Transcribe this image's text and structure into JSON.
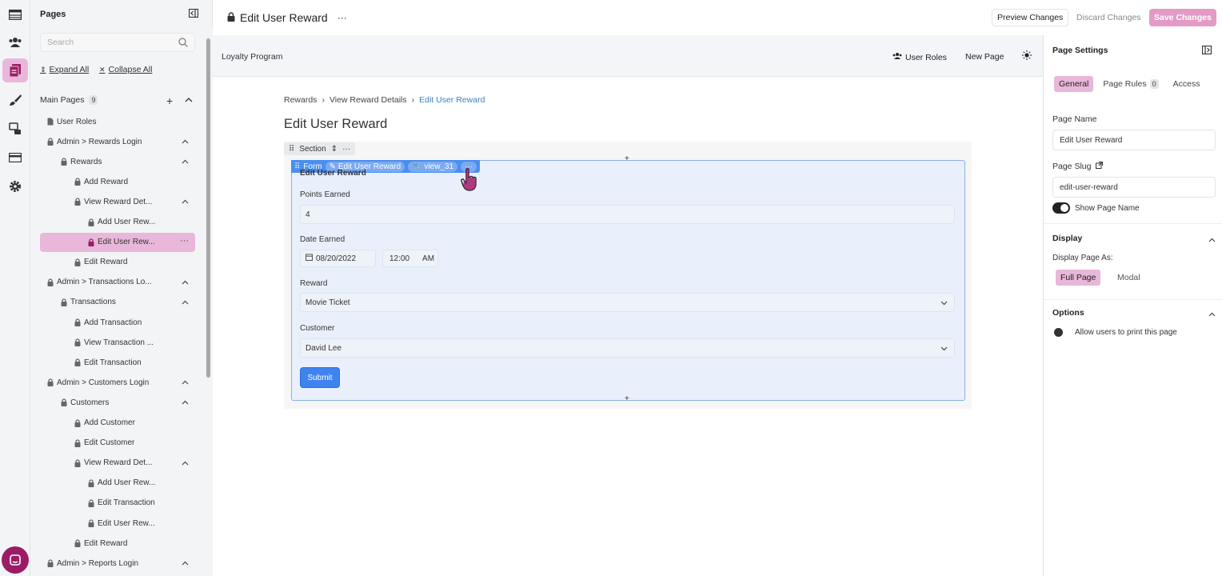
{
  "rail": {
    "icons": [
      "table-icon",
      "users-icon",
      "pages-icon",
      "brush-icon",
      "flows-icon",
      "card-icon",
      "settings-icon"
    ]
  },
  "pages_panel": {
    "title": "Pages",
    "search_placeholder": "Search",
    "expand_all": "Expand All",
    "collapse_all": "Collapse All",
    "main_pages_label": "Main Pages",
    "main_pages_count": "9",
    "tree": [
      {
        "label": "User Roles",
        "indent": 0,
        "icon": "page",
        "caret": false
      },
      {
        "label": "Admin > Rewards Login",
        "indent": 0,
        "icon": "lock",
        "caret": true
      },
      {
        "label": "Rewards",
        "indent": 1,
        "icon": "lock",
        "caret": true
      },
      {
        "label": "Add Reward",
        "indent": 2,
        "icon": "lock",
        "caret": false
      },
      {
        "label": "View Reward Det...",
        "indent": 2,
        "icon": "lock",
        "caret": true
      },
      {
        "label": "Add User Rew...",
        "indent": 3,
        "icon": "lock",
        "caret": false
      },
      {
        "label": "Edit User Rew...",
        "indent": 3,
        "icon": "lock",
        "caret": false,
        "selected": true
      },
      {
        "label": "Edit Reward",
        "indent": 2,
        "icon": "lock",
        "caret": false
      },
      {
        "label": "Admin > Transactions Lo...",
        "indent": 0,
        "icon": "lock",
        "caret": true
      },
      {
        "label": "Transactions",
        "indent": 1,
        "icon": "lock",
        "caret": true
      },
      {
        "label": "Add Transaction",
        "indent": 2,
        "icon": "lock",
        "caret": false
      },
      {
        "label": "View Transaction ...",
        "indent": 2,
        "icon": "lock",
        "caret": false
      },
      {
        "label": "Edit Transaction",
        "indent": 2,
        "icon": "lock",
        "caret": false
      },
      {
        "label": "Admin > Customers Login",
        "indent": 0,
        "icon": "lock",
        "caret": true
      },
      {
        "label": "Customers",
        "indent": 1,
        "icon": "lock",
        "caret": true
      },
      {
        "label": "Add Customer",
        "indent": 2,
        "icon": "lock",
        "caret": false
      },
      {
        "label": "Edit Customer",
        "indent": 2,
        "icon": "lock",
        "caret": false
      },
      {
        "label": "View Reward Det...",
        "indent": 2,
        "icon": "lock",
        "caret": true
      },
      {
        "label": "Add User Rew...",
        "indent": 3,
        "icon": "lock",
        "caret": false
      },
      {
        "label": "Edit Transaction",
        "indent": 3,
        "icon": "lock",
        "caret": false
      },
      {
        "label": "Edit User Rew...",
        "indent": 3,
        "icon": "lock",
        "caret": false
      },
      {
        "label": "Edit Reward",
        "indent": 2,
        "icon": "lock",
        "caret": false
      },
      {
        "label": "Admin > Reports Login",
        "indent": 0,
        "icon": "lock",
        "caret": true
      }
    ]
  },
  "topbar": {
    "page_title": "Edit User Reward",
    "more": "···",
    "preview": "Preview Changes",
    "discard": "Discard Changes",
    "save": "Save Changes"
  },
  "preview_bar": {
    "app_name": "Loyalty Program",
    "user_roles": "User Roles",
    "new_page": "New Page"
  },
  "page": {
    "breadcrumb": [
      "Rewards",
      "View Reward Details",
      "Edit User Reward"
    ],
    "title": "Edit User Reward",
    "section_label": "Section",
    "form_label": "Form",
    "form_chip_1": "Edit User Reward",
    "form_chip_2": "view_31",
    "form_heading": "Edit User Reward",
    "fields": {
      "points_label": "Points Earned",
      "points_value": "4",
      "date_label": "Date Earned",
      "date_value": "08/20/2022",
      "time_value": "12:00",
      "ampm_value": "AM",
      "reward_label": "Reward",
      "reward_value": "Movie Ticket",
      "customer_label": "Customer",
      "customer_value": "David Lee"
    },
    "submit": "Submit"
  },
  "settings": {
    "title": "Page Settings",
    "tabs": {
      "general": "General",
      "rules": "Page Rules",
      "rules_count": "0",
      "access": "Access"
    },
    "page_name_label": "Page Name",
    "page_name_value": "Edit User Reward",
    "page_slug_label": "Page Slug",
    "page_slug_value": "edit-user-reward",
    "show_page_name": "Show Page Name",
    "display_heading": "Display",
    "display_as_label": "Display Page As:",
    "full_page": "Full Page",
    "modal": "Modal",
    "options_heading": "Options",
    "print_option": "Allow users to print this page"
  },
  "colors": {
    "accent": "#e8b7d9",
    "brand": "#9b1b66",
    "form_blue": "#4a8ef0",
    "link_blue": "#3b82c4"
  }
}
